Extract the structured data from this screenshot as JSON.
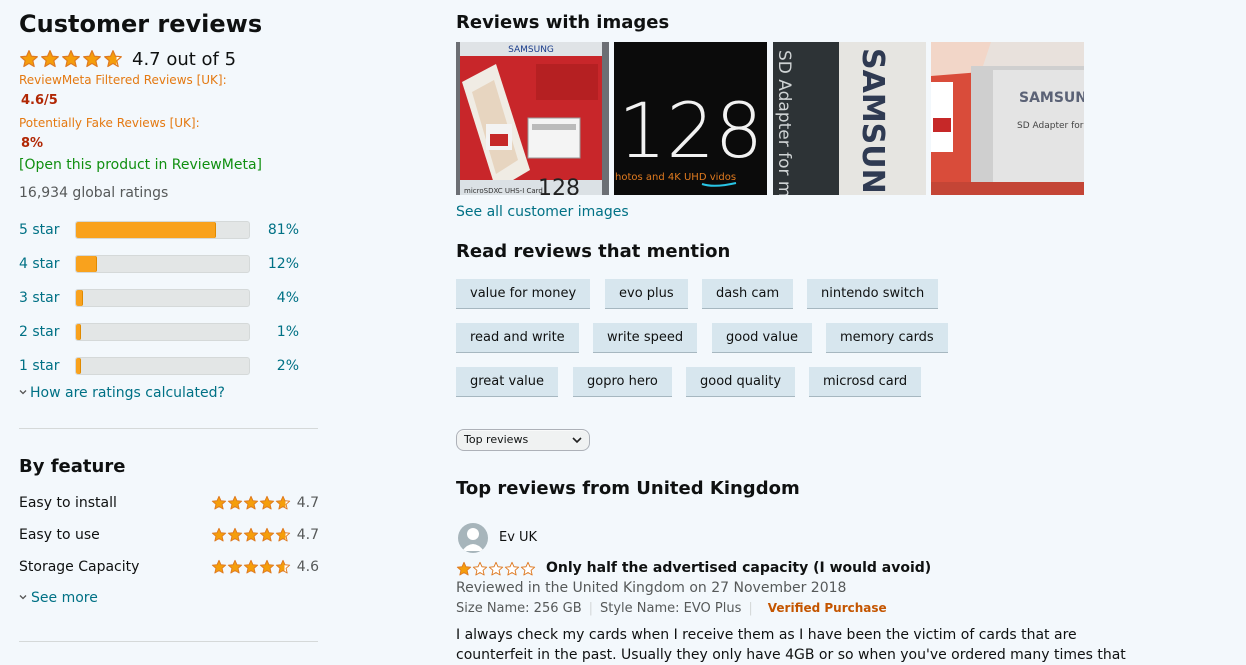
{
  "summary": {
    "title": "Customer reviews",
    "average_rating": 4.7,
    "average_text": "4.7 out of 5",
    "reviewmeta": {
      "filtered_label": "ReviewMeta Filtered Reviews [UK]:",
      "filtered_value": "4.6/5",
      "fake_label": "Potentially Fake Reviews [UK]:",
      "fake_value": "8%",
      "open_link": "[Open this product in ReviewMeta]"
    },
    "global_ratings": "16,934 global ratings",
    "histogram": [
      {
        "label": "5 star",
        "percent": 81,
        "percent_text": "81%"
      },
      {
        "label": "4 star",
        "percent": 12,
        "percent_text": "12%"
      },
      {
        "label": "3 star",
        "percent": 4,
        "percent_text": "4%"
      },
      {
        "label": "2 star",
        "percent": 1,
        "percent_text": "1%"
      },
      {
        "label": "1 star",
        "percent": 2,
        "percent_text": "2%"
      }
    ],
    "how_calculated": "How are ratings calculated?"
  },
  "by_feature": {
    "title": "By feature",
    "features": [
      {
        "name": "Easy to install",
        "rating": 4.7,
        "value": "4.7"
      },
      {
        "name": "Easy to use",
        "rating": 4.7,
        "value": "4.7"
      },
      {
        "name": "Storage Capacity",
        "rating": 4.6,
        "value": "4.6"
      }
    ],
    "see_more": "See more"
  },
  "images": {
    "title": "Reviews with images",
    "see_all": "See all customer images",
    "thumb_texts": {
      "brand": "SAMSUNG",
      "card_label": "microSDXC UHS-I Card",
      "capacity": "128",
      "capacity_partial": "128",
      "photo_caption": "hotos and 4K UHD vidos",
      "adapter_text": "SD Adapter for m",
      "adapter_text_short": "SD Adapter for"
    }
  },
  "mentions": {
    "title": "Read reviews that mention",
    "chips": [
      [
        "value for money",
        "evo plus",
        "dash cam",
        "nintendo switch"
      ],
      [
        "read and write",
        "write speed",
        "good value",
        "memory cards"
      ],
      [
        "great value",
        "gopro hero",
        "good quality",
        "microsd card"
      ]
    ]
  },
  "sort": {
    "selected": "Top reviews"
  },
  "top_reviews": {
    "title": "Top reviews from United Kingdom",
    "review": {
      "author": "Ev UK",
      "rating": 1,
      "title": "Only half the advertised capacity (I would avoid)",
      "meta": "Reviewed in the United Kingdom on 27 November 2018",
      "size": "Size Name: 256 GB",
      "style": "Style Name: EVO Plus",
      "verified": "Verified Purchase",
      "body": "I always check my cards when I receive them as I have been the victim of cards that are counterfeit in the past. Usually they only have 4GB or so when you've ordered many times that"
    }
  },
  "colors": {
    "star": "#f59e0b",
    "link": "#007185",
    "bar_fill": "#f9a21d",
    "chip_bg": "#d7e6ee",
    "verified": "#c45500",
    "reviewmeta_label": "#e47911",
    "reviewmeta_value": "#b12704",
    "reviewmeta_link": "#108f10"
  }
}
